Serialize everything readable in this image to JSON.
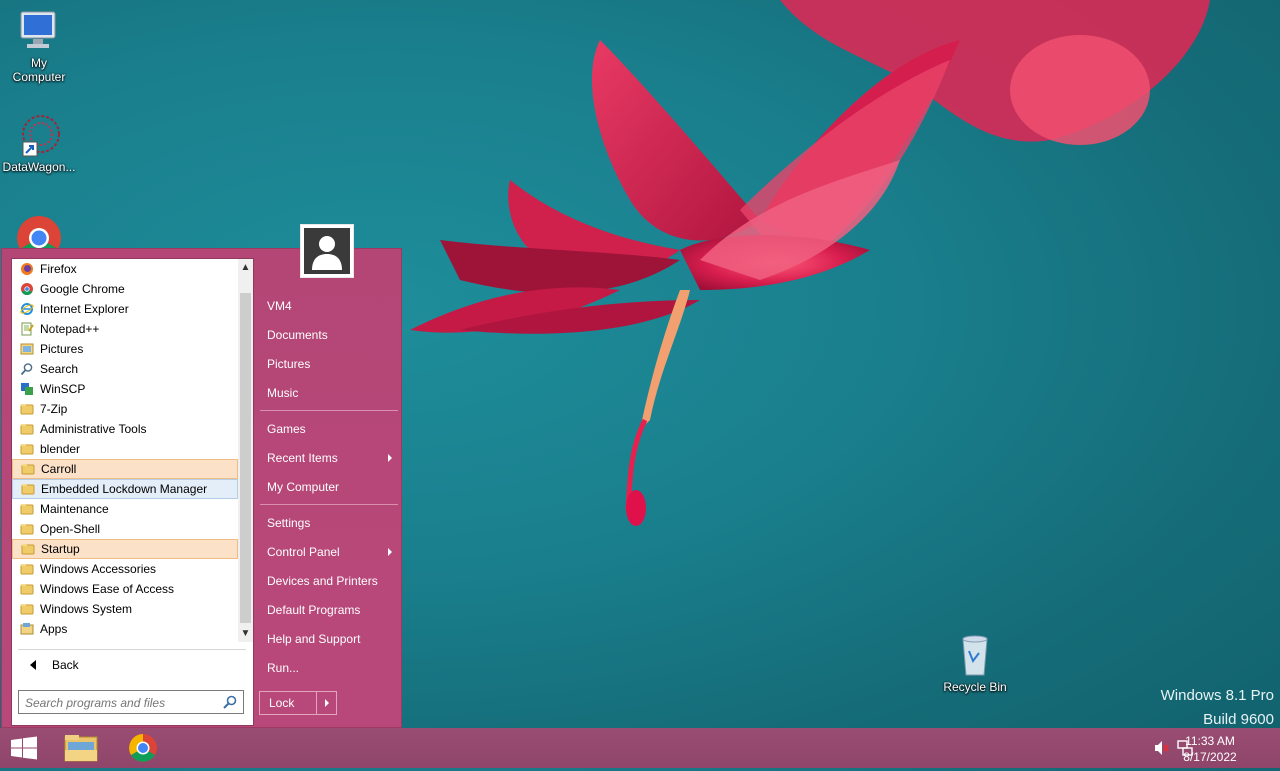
{
  "desktop": {
    "icons": [
      {
        "label_1": "My",
        "label_2": "Computer"
      },
      {
        "label": "DataWagon..."
      },
      {
        "label": "Recycle Bin"
      }
    ],
    "watermark": {
      "line1": "Windows 8.1 Pro",
      "line2": "Build 9600"
    }
  },
  "start_menu": {
    "programs": [
      {
        "label": "Firefox",
        "icon": "firefox-icon"
      },
      {
        "label": "Google Chrome",
        "icon": "chrome-icon"
      },
      {
        "label": "Internet Explorer",
        "icon": "ie-icon"
      },
      {
        "label": "Notepad++",
        "icon": "notepadpp-icon"
      },
      {
        "label": "Pictures",
        "icon": "pictures-icon"
      },
      {
        "label": "Search",
        "icon": "search-icon"
      },
      {
        "label": "WinSCP",
        "icon": "winscp-icon"
      },
      {
        "label": "7-Zip",
        "icon": "folder-icon"
      },
      {
        "label": "Administrative Tools",
        "icon": "folder-icon"
      },
      {
        "label": "blender",
        "icon": "folder-icon"
      },
      {
        "label": "Carroll",
        "icon": "folder-icon",
        "highlight": "orange"
      },
      {
        "label": "Embedded Lockdown Manager",
        "icon": "folder-icon",
        "highlight": "blue"
      },
      {
        "label": "Maintenance",
        "icon": "folder-icon"
      },
      {
        "label": "Open-Shell",
        "icon": "folder-icon"
      },
      {
        "label": "Startup",
        "icon": "folder-icon",
        "highlight": "orange"
      },
      {
        "label": "Windows Accessories",
        "icon": "folder-icon"
      },
      {
        "label": "Windows Ease of Access",
        "icon": "folder-icon"
      },
      {
        "label": "Windows System",
        "icon": "folder-icon"
      },
      {
        "label": "Apps",
        "icon": "apps-icon"
      }
    ],
    "back_label": "Back",
    "search_placeholder": "Search programs and files",
    "right_items": [
      {
        "label": "VM4"
      },
      {
        "label": "Documents"
      },
      {
        "label": "Pictures"
      },
      {
        "label": "Music"
      },
      {
        "label": "Games"
      },
      {
        "label": "Recent Items",
        "submenu": true
      },
      {
        "label": "My Computer"
      },
      {
        "label": "Settings"
      },
      {
        "label": "Control Panel",
        "submenu": true
      },
      {
        "label": "Devices and Printers"
      },
      {
        "label": "Default Programs"
      },
      {
        "label": "Help and Support"
      },
      {
        "label": "Run..."
      }
    ],
    "lock_label": "Lock"
  },
  "taskbar": {
    "time": "11:33 AM",
    "date": "8/17/2022"
  },
  "colors": {
    "start_menu_bg": "#c04a79",
    "taskbar_bg": "#944a6e",
    "highlight_orange": "#fbe1c8",
    "highlight_blue": "#e4eef9"
  }
}
